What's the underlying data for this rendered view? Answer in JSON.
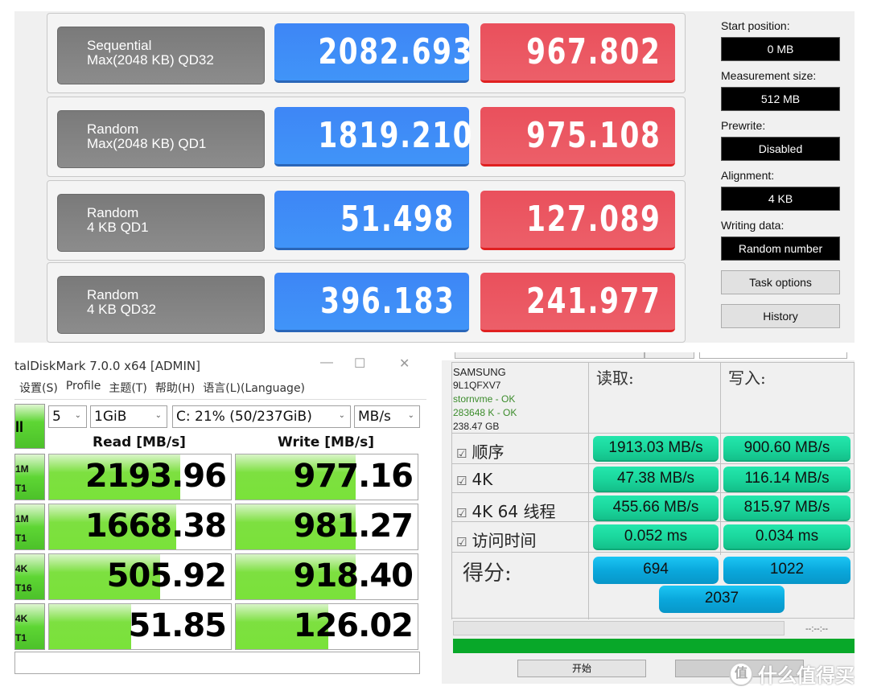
{
  "panel_a": {
    "rows": [
      {
        "label1": "Sequential",
        "label2": "Max(2048 KB) QD32",
        "read": "2082.693",
        "write": "967.802"
      },
      {
        "label1": "Random",
        "label2": "Max(2048 KB) QD1",
        "read": "1819.210",
        "write": "975.108"
      },
      {
        "label1": "Random",
        "label2": "4 KB QD1",
        "read": "51.498",
        "write": "127.089"
      },
      {
        "label1": "Random",
        "label2": "4 KB QD32",
        "read": "396.183",
        "write": "241.977"
      }
    ],
    "settings": [
      {
        "label": "Start position:",
        "value": "0 MB"
      },
      {
        "label": "Measurement size:",
        "value": "512 MB"
      },
      {
        "label": "Prewrite:",
        "value": "Disabled"
      },
      {
        "label": "Alignment:",
        "value": "4 KB"
      },
      {
        "label": "Writing data:",
        "value": "Random number"
      }
    ],
    "buttons": {
      "task_options": "Task options",
      "history": "History"
    },
    "colors": {
      "read": "#3e86f6",
      "write": "#ea505c"
    }
  },
  "panel_b": {
    "title": "talDiskMark 7.0.0 x64 [ADMIN]",
    "window_buttons": {
      "minimize": "—",
      "maximize": "☐",
      "close": "✕"
    },
    "menu": [
      "设置(S)",
      "Profile",
      "主题(T)",
      "帮助(H)",
      "语言(L)(Language)"
    ],
    "all_button": "ll",
    "selects": {
      "count": "5",
      "size": "1GiB",
      "drive": "C: 21% (50/237GiB)",
      "unit": "MB/s"
    },
    "headers": {
      "read": "Read [MB/s]",
      "write": "Write [MB/s]"
    },
    "rows": [
      {
        "label1": "1M",
        "label2": "T1",
        "read": "2193.96",
        "write": "977.16",
        "read_fill": 0.72,
        "write_fill": 0.66
      },
      {
        "label1": "1M",
        "label2": "T1",
        "read": "1668.38",
        "write": "981.27",
        "read_fill": 0.7,
        "write_fill": 0.66
      },
      {
        "label1": "4K",
        "label2": "T16",
        "read": "505.92",
        "write": "918.40",
        "read_fill": 0.61,
        "write_fill": 0.66
      },
      {
        "label1": "4K",
        "label2": "T1",
        "read": "51.85",
        "write": "126.02",
        "read_fill": 0.45,
        "write_fill": 0.51
      }
    ]
  },
  "panel_c": {
    "drive": {
      "vendor": "SAMSUNG",
      "model": "9L1QFXV7",
      "driver": "stornvme - OK",
      "align": "283648 K - OK",
      "size": "238.47 GB"
    },
    "headers": {
      "read": "读取:",
      "write": "写入:"
    },
    "rows": [
      {
        "label": "顺序",
        "read": "1913.03 MB/s",
        "write": "900.60 MB/s"
      },
      {
        "label": "4K",
        "read": "47.38 MB/s",
        "write": "116.14 MB/s"
      },
      {
        "label": "4K 64 线程",
        "read": "455.66 MB/s",
        "write": "815.97 MB/s"
      },
      {
        "label": "访问时间",
        "read": "0.052 ms",
        "write": "0.034 ms"
      }
    ],
    "score_label": "得分:",
    "scores": {
      "read": "694",
      "write": "1022",
      "total": "2037"
    },
    "time": "--:--:--",
    "progress": 1.0,
    "buttons": {
      "start": "开始",
      "abort": ""
    },
    "checkbox": "☑"
  },
  "watermark": {
    "icon": "值",
    "text": "什么值得买"
  }
}
